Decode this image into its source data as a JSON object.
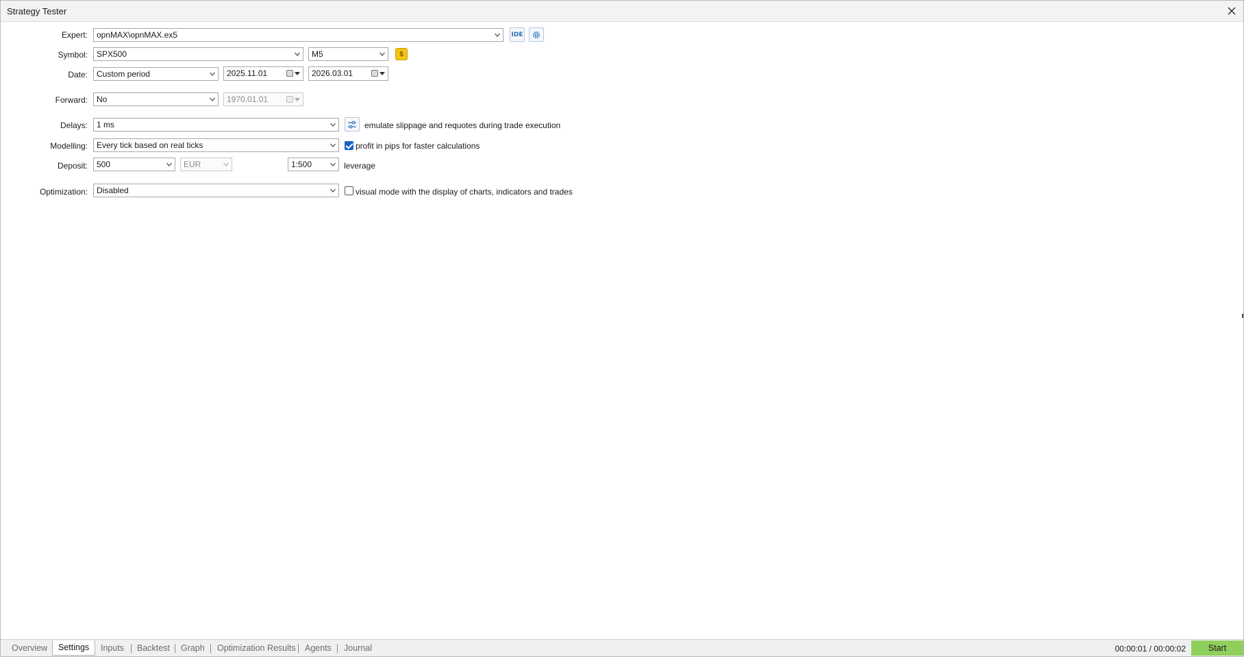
{
  "window": {
    "title": "Strategy Tester"
  },
  "expert": {
    "label": "Expert:",
    "value": "opnMAX\\opnMAX.ex5",
    "ide_label": "IDE"
  },
  "symbol": {
    "label": "Symbol:",
    "value": "SPX500",
    "timeframe": "M5"
  },
  "date": {
    "label": "Date:",
    "period": "Custom period",
    "from": "2025.11.01",
    "to": "2026.03.01"
  },
  "forward": {
    "label": "Forward:",
    "value": "No",
    "date": "1970.01.01"
  },
  "delays": {
    "label": "Delays:",
    "value": "1 ms",
    "emulate_text": "emulate slippage and requotes during trade execution"
  },
  "modelling": {
    "label": "Modelling:",
    "value": "Every tick based on real ticks",
    "pips_checked": true,
    "pips_text": "profit in pips for faster calculations"
  },
  "deposit": {
    "label": "Deposit:",
    "value": "500",
    "currency": "EUR",
    "leverage": "1:500",
    "leverage_text": "leverage"
  },
  "optimization": {
    "label": "Optimization:",
    "value": "Disabled",
    "visual_checked": false,
    "visual_text": "visual mode with the display of charts, indicators and trades"
  },
  "tabs": [
    {
      "label": "Overview",
      "active": false
    },
    {
      "label": "Settings",
      "active": true
    },
    {
      "label": "Inputs",
      "active": false
    },
    {
      "label": "Backtest",
      "active": false
    },
    {
      "label": "Graph",
      "active": false
    },
    {
      "label": "Optimization Results",
      "active": false
    },
    {
      "label": "Agents",
      "active": false
    },
    {
      "label": "Journal",
      "active": false
    }
  ],
  "status": {
    "timer": "00:00:01 / 00:00:02",
    "start_label": "Start"
  },
  "colors": {
    "start_button": "#8fcf5b",
    "checkbox_on": "#1a62c7",
    "coin": "#f5c518"
  }
}
